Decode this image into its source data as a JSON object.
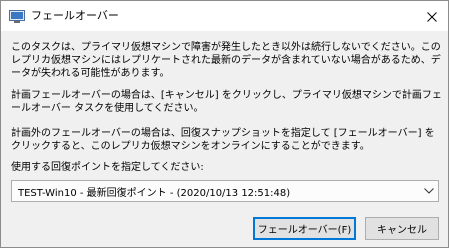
{
  "window": {
    "title": "フェールオーバー",
    "close_label": "✕"
  },
  "body": {
    "paragraph1": "このタスクは、プライマリ仮想マシンで障害が発生したとき以外は続行しないでください。このレプリカ仮想マシンにはレプリケートされた最新のデータが含まれていない場合があるため、データが失われる可能性があります。",
    "paragraph2": "計画フェールオーバーの場合は、[キャンセル] をクリックし、プライマリ仮想マシンで計画フェールオーバー タスクを使用してください。",
    "paragraph3": "計画外のフェールオーバーの場合は、回復スナップショットを指定して [フェールオーバー] をクリックすると、このレプリカ仮想マシンをオンラインにすることができます。",
    "select_label": "使用する回復ポイントを指定してください:"
  },
  "recovery_point": {
    "selected": "TEST-Win10 - 最新回復ポイント - (2020/10/13 12:51:48)"
  },
  "buttons": {
    "failover": "フェールオーバー(F)",
    "cancel": "キャンセル"
  },
  "colors": {
    "window_bg": "#f0f0f0",
    "titlebar_bg": "#ffffff",
    "accent": "#0078d7"
  },
  "icons": {
    "app": "failover-app-icon",
    "close": "close-icon",
    "dropdown": "chevron-down-icon"
  }
}
